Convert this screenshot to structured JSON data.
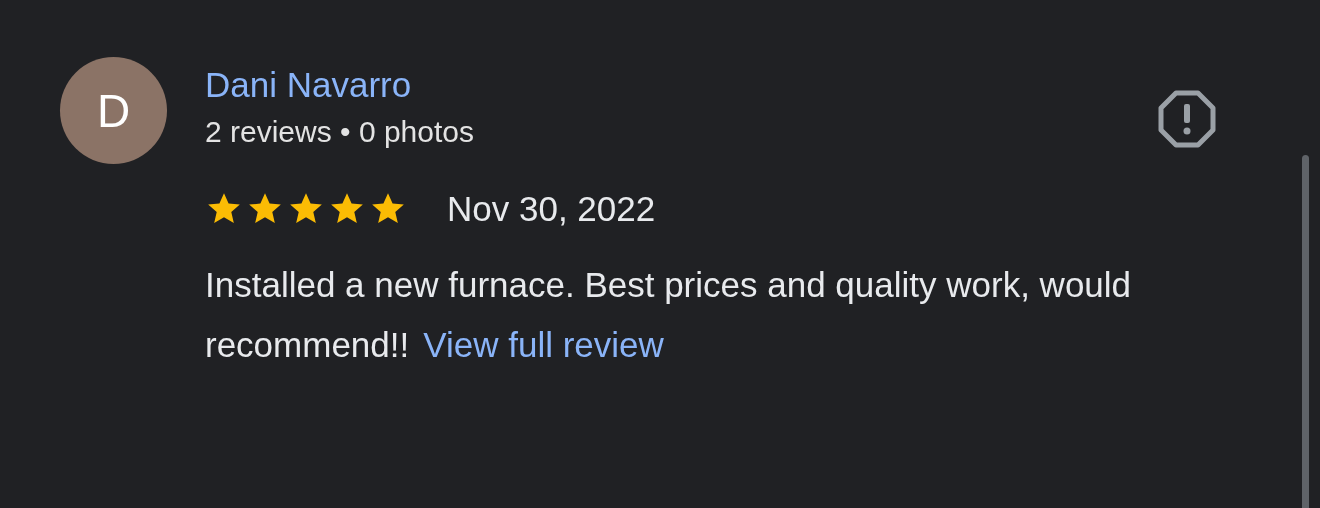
{
  "review": {
    "avatar_letter": "D",
    "author": "Dani Navarro",
    "meta": "2 reviews • 0 photos",
    "stars": 5,
    "date": "Nov 30, 2022",
    "text": "Installed a new furnace. Best prices and quality work, would recommend!!",
    "link": "View full review"
  }
}
